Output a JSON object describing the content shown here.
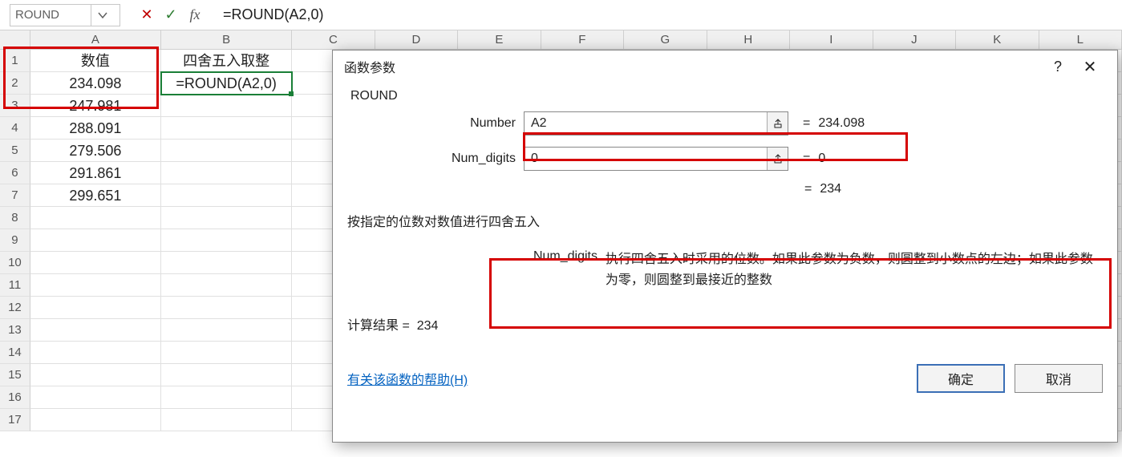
{
  "formula_bar": {
    "name_box": "ROUND",
    "formula": "=ROUND(A2,0)"
  },
  "columns": [
    "A",
    "B",
    "C",
    "D",
    "E",
    "F",
    "G",
    "H",
    "I",
    "J",
    "K",
    "L"
  ],
  "table": {
    "header_a": "数值",
    "header_b": "四舍五入取整",
    "rows": [
      {
        "n": "1",
        "a": "数值",
        "b": "四舍五入取整"
      },
      {
        "n": "2",
        "a": "234.098",
        "b": "=ROUND(A2,0)"
      },
      {
        "n": "3",
        "a": "247.981",
        "b": ""
      },
      {
        "n": "4",
        "a": "288.091",
        "b": ""
      },
      {
        "n": "5",
        "a": "279.506",
        "b": ""
      },
      {
        "n": "6",
        "a": "291.861",
        "b": ""
      },
      {
        "n": "7",
        "a": "299.651",
        "b": ""
      },
      {
        "n": "8",
        "a": "",
        "b": ""
      },
      {
        "n": "9",
        "a": "",
        "b": ""
      },
      {
        "n": "10",
        "a": "",
        "b": ""
      },
      {
        "n": "11",
        "a": "",
        "b": ""
      },
      {
        "n": "12",
        "a": "",
        "b": ""
      },
      {
        "n": "13",
        "a": "",
        "b": ""
      },
      {
        "n": "14",
        "a": "",
        "b": ""
      },
      {
        "n": "15",
        "a": "",
        "b": ""
      },
      {
        "n": "16",
        "a": "",
        "b": ""
      },
      {
        "n": "17",
        "a": "",
        "b": ""
      }
    ]
  },
  "dialog": {
    "title": "函数参数",
    "help_icon": "?",
    "close_icon": "✕",
    "func_name": "ROUND",
    "args": {
      "number": {
        "label": "Number",
        "value": "A2",
        "result": "234.098"
      },
      "num_digits": {
        "label": "Num_digits",
        "value": "0",
        "result": "0"
      }
    },
    "overall_result": "234",
    "desc": "按指定的位数对数值进行四舍五入",
    "param_desc_label": "Num_digits",
    "param_desc_text": "执行四舍五入时采用的位数。如果此参数为负数，则圆整到小数点的左边；如果此参数为零，则圆整到最接近的整数",
    "calc_result_label": "计算结果 =",
    "calc_result_value": "234",
    "help_link": "有关该函数的帮助(H)",
    "ok": "确定",
    "cancel": "取消",
    "eq": "="
  }
}
